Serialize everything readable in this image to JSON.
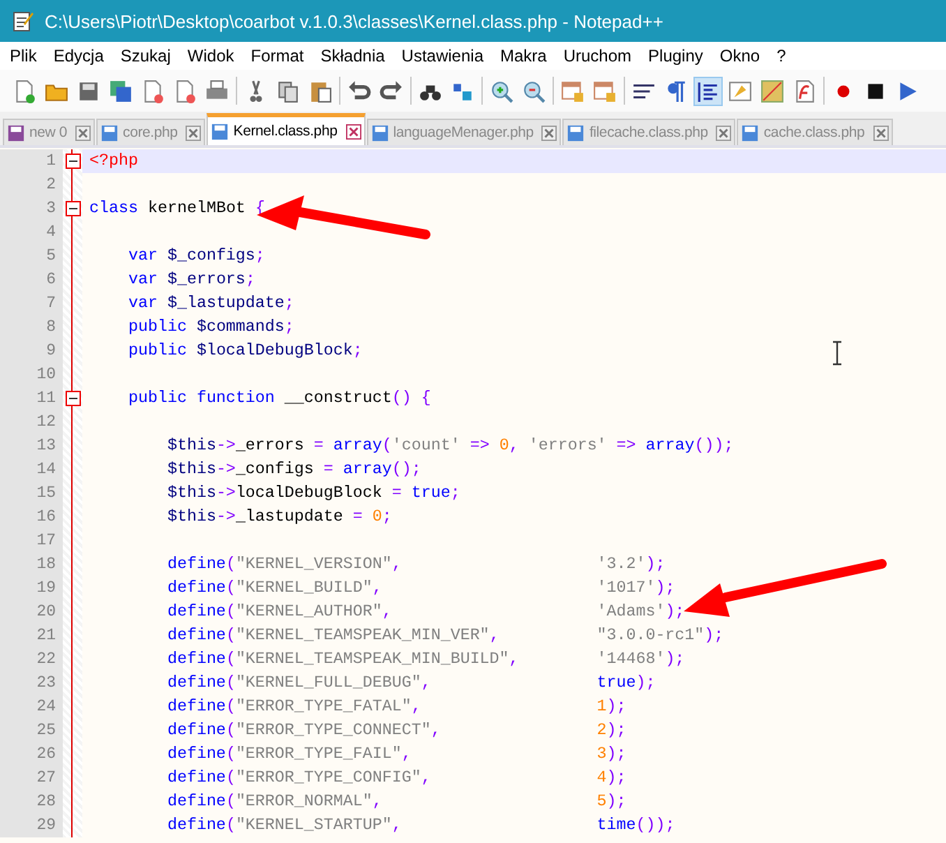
{
  "window": {
    "title": "C:\\Users\\Piotr\\Desktop\\coarbot v.1.0.3\\classes\\Kernel.class.php - Notepad++"
  },
  "menu": [
    "Plik",
    "Edycja",
    "Szukaj",
    "Widok",
    "Format",
    "Składnia",
    "Ustawienia",
    "Makra",
    "Uruchom",
    "Pluginy",
    "Okno",
    "?"
  ],
  "tabs": [
    {
      "label": "new  0",
      "selected": false
    },
    {
      "label": "core.php",
      "selected": false
    },
    {
      "label": "Kernel.class.php",
      "selected": true
    },
    {
      "label": "languageMenager.php",
      "selected": false
    },
    {
      "label": "filecache.class.php",
      "selected": false
    },
    {
      "label": "cache.class.php",
      "selected": false
    }
  ],
  "editor": {
    "lines": [
      {
        "number": "1",
        "fold": true,
        "selected": true,
        "code": [
          {
            "kind": "tag",
            "text": "<?php"
          }
        ]
      },
      {
        "number": "2",
        "fold": false,
        "selected": false
      },
      {
        "number": "3",
        "fold": true,
        "selected": false,
        "code": [
          {
            "kind": "kw",
            "text": "class"
          },
          {
            "kind": "plain",
            "text": " kernelMBot "
          },
          {
            "kind": "op",
            "text": "{"
          }
        ]
      },
      {
        "number": "4",
        "fold": false,
        "selected": false
      },
      {
        "number": "5",
        "fold": false,
        "selected": false,
        "code": [
          {
            "kind": "kw",
            "text": "    var"
          },
          {
            "kind": "var",
            "text": " $_configs"
          },
          {
            "kind": "op",
            "text": ";"
          }
        ]
      },
      {
        "number": "6",
        "fold": false,
        "selected": false,
        "code": [
          {
            "kind": "kw",
            "text": "    var"
          },
          {
            "kind": "var",
            "text": " $_errors"
          },
          {
            "kind": "op",
            "text": ";"
          }
        ]
      },
      {
        "number": "7",
        "fold": false,
        "selected": false,
        "code": [
          {
            "kind": "kw",
            "text": "    var"
          },
          {
            "kind": "var",
            "text": " $_lastupdate"
          },
          {
            "kind": "op",
            "text": ";"
          }
        ]
      },
      {
        "number": "8",
        "fold": false,
        "selected": false,
        "code": [
          {
            "kind": "kw",
            "text": "    public"
          },
          {
            "kind": "var",
            "text": " $commands"
          },
          {
            "kind": "op",
            "text": ";"
          }
        ]
      },
      {
        "number": "9",
        "fold": false,
        "selected": false,
        "code": [
          {
            "kind": "kw",
            "text": "    public"
          },
          {
            "kind": "var",
            "text": " $localDebugBlock"
          },
          {
            "kind": "op",
            "text": ";"
          }
        ]
      },
      {
        "number": "10",
        "fold": false,
        "selected": false
      },
      {
        "number": "11",
        "fold": true,
        "selected": false,
        "code": [
          {
            "kind": "kw",
            "text": "    public function"
          },
          {
            "kind": "plain",
            "text": " __construct"
          },
          {
            "kind": "op",
            "text": "() {"
          }
        ]
      },
      {
        "number": "12",
        "fold": false,
        "selected": false
      },
      {
        "number": "13",
        "fold": false,
        "selected": false,
        "code": [
          {
            "kind": "var",
            "text": "        $this"
          },
          {
            "kind": "op",
            "text": "->"
          },
          {
            "kind": "plain",
            "text": "_errors "
          },
          {
            "kind": "op",
            "text": "= "
          },
          {
            "kind": "kw",
            "text": "array"
          },
          {
            "kind": "op",
            "text": "("
          },
          {
            "kind": "str",
            "text": "'count'"
          },
          {
            "kind": "op",
            "text": " => "
          },
          {
            "kind": "num",
            "text": "0"
          },
          {
            "kind": "op",
            "text": ", "
          },
          {
            "kind": "str",
            "text": "'errors'"
          },
          {
            "kind": "op",
            "text": " => "
          },
          {
            "kind": "kw",
            "text": "array"
          },
          {
            "kind": "op",
            "text": "());"
          }
        ]
      },
      {
        "number": "14",
        "fold": false,
        "selected": false,
        "code": [
          {
            "kind": "var",
            "text": "        $this"
          },
          {
            "kind": "op",
            "text": "->"
          },
          {
            "kind": "plain",
            "text": "_configs "
          },
          {
            "kind": "op",
            "text": "= "
          },
          {
            "kind": "kw",
            "text": "array"
          },
          {
            "kind": "op",
            "text": "();"
          }
        ]
      },
      {
        "number": "15",
        "fold": false,
        "selected": false,
        "code": [
          {
            "kind": "var",
            "text": "        $this"
          },
          {
            "kind": "op",
            "text": "->"
          },
          {
            "kind": "plain",
            "text": "localDebugBlock "
          },
          {
            "kind": "op",
            "text": "= "
          },
          {
            "kind": "kw",
            "text": "true"
          },
          {
            "kind": "op",
            "text": ";"
          }
        ]
      },
      {
        "number": "16",
        "fold": false,
        "selected": false,
        "code": [
          {
            "kind": "var",
            "text": "        $this"
          },
          {
            "kind": "op",
            "text": "->"
          },
          {
            "kind": "plain",
            "text": "_lastupdate "
          },
          {
            "kind": "op",
            "text": "= "
          },
          {
            "kind": "num",
            "text": "0"
          },
          {
            "kind": "op",
            "text": ";"
          }
        ]
      },
      {
        "number": "17",
        "fold": false,
        "selected": false
      },
      {
        "number": "18",
        "fold": false,
        "selected": false,
        "code": [
          {
            "kind": "kw",
            "text": "        define"
          },
          {
            "kind": "op",
            "text": "("
          },
          {
            "kind": "str",
            "text": "\"KERNEL_VERSION\""
          },
          {
            "kind": "op",
            "text": ","
          }
        ],
        "value": [
          {
            "kind": "str",
            "text": "'3.2'"
          },
          {
            "kind": "op",
            "text": ");"
          }
        ]
      },
      {
        "number": "19",
        "fold": false,
        "selected": false,
        "code": [
          {
            "kind": "kw",
            "text": "        define"
          },
          {
            "kind": "op",
            "text": "("
          },
          {
            "kind": "str",
            "text": "\"KERNEL_BUILD\""
          },
          {
            "kind": "op",
            "text": ","
          }
        ],
        "value": [
          {
            "kind": "str",
            "text": "'1017'"
          },
          {
            "kind": "op",
            "text": ");"
          }
        ]
      },
      {
        "number": "20",
        "fold": false,
        "selected": false,
        "code": [
          {
            "kind": "kw",
            "text": "        define"
          },
          {
            "kind": "op",
            "text": "("
          },
          {
            "kind": "str",
            "text": "\"KERNEL_AUTHOR\""
          },
          {
            "kind": "op",
            "text": ","
          }
        ],
        "value": [
          {
            "kind": "str",
            "text": "'Adams'"
          },
          {
            "kind": "op",
            "text": ");"
          }
        ]
      },
      {
        "number": "21",
        "fold": false,
        "selected": false,
        "code": [
          {
            "kind": "kw",
            "text": "        define"
          },
          {
            "kind": "op",
            "text": "("
          },
          {
            "kind": "str",
            "text": "\"KERNEL_TEAMSPEAK_MIN_VER\""
          },
          {
            "kind": "op",
            "text": ","
          }
        ],
        "value": [
          {
            "kind": "str",
            "text": "\"3.0.0-rc1\""
          },
          {
            "kind": "op",
            "text": ");"
          }
        ]
      },
      {
        "number": "22",
        "fold": false,
        "selected": false,
        "code": [
          {
            "kind": "kw",
            "text": "        define"
          },
          {
            "kind": "op",
            "text": "("
          },
          {
            "kind": "str",
            "text": "\"KERNEL_TEAMSPEAK_MIN_BUILD\""
          },
          {
            "kind": "op",
            "text": ","
          }
        ],
        "value": [
          {
            "kind": "str",
            "text": "'14468'"
          },
          {
            "kind": "op",
            "text": ");"
          }
        ]
      },
      {
        "number": "23",
        "fold": false,
        "selected": false,
        "code": [
          {
            "kind": "kw",
            "text": "        define"
          },
          {
            "kind": "op",
            "text": "("
          },
          {
            "kind": "str",
            "text": "\"KERNEL_FULL_DEBUG\""
          },
          {
            "kind": "op",
            "text": ","
          }
        ],
        "value": [
          {
            "kind": "kw",
            "text": "true"
          },
          {
            "kind": "op",
            "text": ");"
          }
        ]
      },
      {
        "number": "24",
        "fold": false,
        "selected": false,
        "code": [
          {
            "kind": "kw",
            "text": "        define"
          },
          {
            "kind": "op",
            "text": "("
          },
          {
            "kind": "str",
            "text": "\"ERROR_TYPE_FATAL\""
          },
          {
            "kind": "op",
            "text": ","
          }
        ],
        "value": [
          {
            "kind": "num",
            "text": "1"
          },
          {
            "kind": "op",
            "text": ");"
          }
        ]
      },
      {
        "number": "25",
        "fold": false,
        "selected": false,
        "code": [
          {
            "kind": "kw",
            "text": "        define"
          },
          {
            "kind": "op",
            "text": "("
          },
          {
            "kind": "str",
            "text": "\"ERROR_TYPE_CONNECT\""
          },
          {
            "kind": "op",
            "text": ","
          }
        ],
        "value": [
          {
            "kind": "num",
            "text": "2"
          },
          {
            "kind": "op",
            "text": ");"
          }
        ]
      },
      {
        "number": "26",
        "fold": false,
        "selected": false,
        "code": [
          {
            "kind": "kw",
            "text": "        define"
          },
          {
            "kind": "op",
            "text": "("
          },
          {
            "kind": "str",
            "text": "\"ERROR_TYPE_FAIL\""
          },
          {
            "kind": "op",
            "text": ","
          }
        ],
        "value": [
          {
            "kind": "num",
            "text": "3"
          },
          {
            "kind": "op",
            "text": ");"
          }
        ]
      },
      {
        "number": "27",
        "fold": false,
        "selected": false,
        "code": [
          {
            "kind": "kw",
            "text": "        define"
          },
          {
            "kind": "op",
            "text": "("
          },
          {
            "kind": "str",
            "text": "\"ERROR_TYPE_CONFIG\""
          },
          {
            "kind": "op",
            "text": ","
          }
        ],
        "value": [
          {
            "kind": "num",
            "text": "4"
          },
          {
            "kind": "op",
            "text": ");"
          }
        ]
      },
      {
        "number": "28",
        "fold": false,
        "selected": false,
        "code": [
          {
            "kind": "kw",
            "text": "        define"
          },
          {
            "kind": "op",
            "text": "("
          },
          {
            "kind": "str",
            "text": "\"ERROR_NORMAL\""
          },
          {
            "kind": "op",
            "text": ","
          }
        ],
        "value": [
          {
            "kind": "num",
            "text": "5"
          },
          {
            "kind": "op",
            "text": ");"
          }
        ]
      },
      {
        "number": "29",
        "fold": false,
        "selected": false,
        "code": [
          {
            "kind": "kw",
            "text": "        define"
          },
          {
            "kind": "op",
            "text": "("
          },
          {
            "kind": "str",
            "text": "\"KERNEL_STARTUP\""
          },
          {
            "kind": "op",
            "text": ","
          }
        ],
        "value": [
          {
            "kind": "kw",
            "text": "time"
          },
          {
            "kind": "op",
            "text": "());"
          }
        ]
      }
    ]
  }
}
